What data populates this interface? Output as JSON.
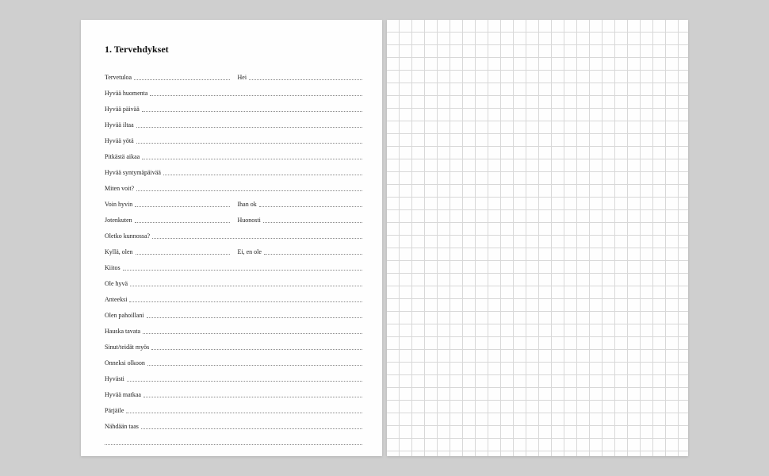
{
  "heading": "1. Tervehdykset",
  "rows": [
    {
      "type": "two",
      "a": "Tervetuloa",
      "b": "Hei"
    },
    {
      "type": "one",
      "a": "Hyvää huomenta"
    },
    {
      "type": "one",
      "a": "Hyvää päivää"
    },
    {
      "type": "one",
      "a": "Hyvää iltaa"
    },
    {
      "type": "one",
      "a": "Hyvää yötä"
    },
    {
      "type": "one",
      "a": "Pitkästä aikaa"
    },
    {
      "type": "one",
      "a": "Hyvää syntymäpäivää"
    },
    {
      "type": "one",
      "a": "Miten voit?"
    },
    {
      "type": "two",
      "a": "Voin hyvin",
      "b": "Ihan ok"
    },
    {
      "type": "two",
      "a": "Jotenkuten",
      "b": "Huonosti"
    },
    {
      "type": "one",
      "a": "Oletko kunnossa?"
    },
    {
      "type": "two",
      "a": "Kyllä, olen",
      "b": "Ei, en ole"
    },
    {
      "type": "one",
      "a": "Kiitos"
    },
    {
      "type": "one",
      "a": "Ole hyvä"
    },
    {
      "type": "one",
      "a": "Anteeksi"
    },
    {
      "type": "one",
      "a": "Olen pahoillani"
    },
    {
      "type": "one",
      "a": "Hauska tavata"
    },
    {
      "type": "one",
      "a": "Sinut/teidät myös"
    },
    {
      "type": "one",
      "a": "Onneksi olkoon"
    },
    {
      "type": "one",
      "a": "Hyvästi"
    },
    {
      "type": "one",
      "a": "Hyvää matkaa"
    },
    {
      "type": "one",
      "a": "Pärjäile"
    },
    {
      "type": "one",
      "a": "Nähdään taas"
    },
    {
      "type": "blank"
    }
  ]
}
